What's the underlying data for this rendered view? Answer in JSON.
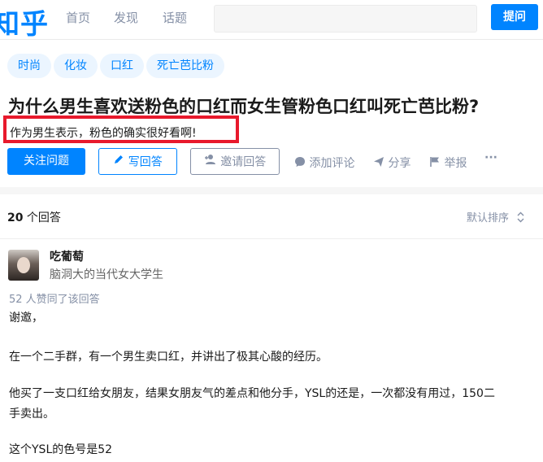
{
  "header": {
    "logo": "知乎",
    "nav": [
      "首页",
      "发现",
      "话题"
    ],
    "search_placeholder": "",
    "ask_label": "提问"
  },
  "question": {
    "tags": [
      "时尚",
      "化妆",
      "口红",
      "死亡芭比粉"
    ],
    "title": "为什么男生喜欢送粉色的口红而女生管粉色口红叫死亡芭比粉?",
    "detail": "作为男生表示，粉色的确实很好看啊!",
    "actions": {
      "follow": "关注问题",
      "write": "写回答",
      "invite": "邀请回答",
      "comment": "添加评论",
      "share": "分享",
      "report": "举报",
      "more": "···"
    }
  },
  "answers": {
    "count_number": "20",
    "count_label": " 个回答",
    "sort_label": "默认排序",
    "first": {
      "author": "吃葡萄",
      "bio": "脑洞大的当代女大学生",
      "votes": "52 人赞同了该回答",
      "paragraphs": [
        "谢邀，",
        "在一个二手群，有一个男生卖口红，并讲出了极其心酸的经历。",
        "他买了一支口红给女朋友，结果女朋友气的差点和他分手，YSL的还是，一次都没有用过，150二",
        "手卖出。",
        "这个YSL的色号是52"
      ]
    }
  },
  "colors": {
    "brand": "#0084ff",
    "highlight": "#e8192c"
  }
}
